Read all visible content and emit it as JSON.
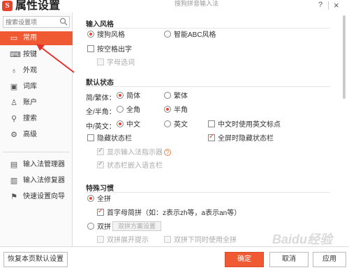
{
  "window": {
    "title": "属性设置",
    "caption": "搜狗拼音输入法",
    "logo_text": "S",
    "help_label": "?",
    "close_label": "×"
  },
  "sidebar": {
    "search_placeholder": "搜索设置项",
    "items": [
      {
        "label": "常用",
        "icon": "monitor-icon",
        "glyph": "▭"
      },
      {
        "label": "按键",
        "icon": "keyboard-icon",
        "glyph": "⌨"
      },
      {
        "label": "外观",
        "icon": "shirt-icon",
        "glyph": "♁"
      },
      {
        "label": "词库",
        "icon": "book-icon",
        "glyph": "▣"
      },
      {
        "label": "账户",
        "icon": "user-icon",
        "glyph": "♙"
      },
      {
        "label": "搜索",
        "icon": "search-icon",
        "glyph": "⚲"
      },
      {
        "label": "高级",
        "icon": "gear-icon",
        "glyph": "⚙"
      }
    ],
    "tools": [
      {
        "label": "输入法管理器",
        "icon": "manager-icon",
        "glyph": "▤"
      },
      {
        "label": "输入法修复器",
        "icon": "repair-icon",
        "glyph": "▥"
      },
      {
        "label": "快速设置向导",
        "icon": "flag-icon",
        "glyph": "⚑"
      }
    ]
  },
  "sections": {
    "input_style": {
      "title": "输入风格",
      "sogou_style": "搜狗风格",
      "abc_style": "智能ABC风格",
      "space_output": "按空格出字",
      "letter_select": "字母选词"
    },
    "default_state": {
      "title": "默认状态",
      "trad_label": "简/繁体：",
      "simplified": "简体",
      "traditional": "繁体",
      "width_label": "全/半角：",
      "full_width": "全角",
      "half_width": "半角",
      "lang_label": "中/英文：",
      "chinese": "中文",
      "english": "英文",
      "english_punct": "中文时使用英文标点",
      "hide_status": "隐藏状态栏",
      "fullscreen_hide": "全屏时隐藏状态栏",
      "show_indicator": "显示输入法指示器",
      "embed_language": "状态栏嵌入语言栏"
    },
    "special": {
      "title": "特殊习惯",
      "quanpin": "全拼",
      "initial_abbr": "首字母简拼（如：z表示zh等，a表示an等）",
      "shuangpin": "双拼",
      "shuangpin_settings": "双拼方案设置",
      "shuangpin_show": "双拼展开提示",
      "shuangpin_both": "双拼下同时使用全拼"
    }
  },
  "footer": {
    "restore": "恢复本页默认设置",
    "ok": "确定",
    "cancel": "取消",
    "apply": "应用"
  },
  "watermark": "Baidu经验",
  "colors": {
    "accent": "#f05a32",
    "arrow": "#e8302a"
  }
}
